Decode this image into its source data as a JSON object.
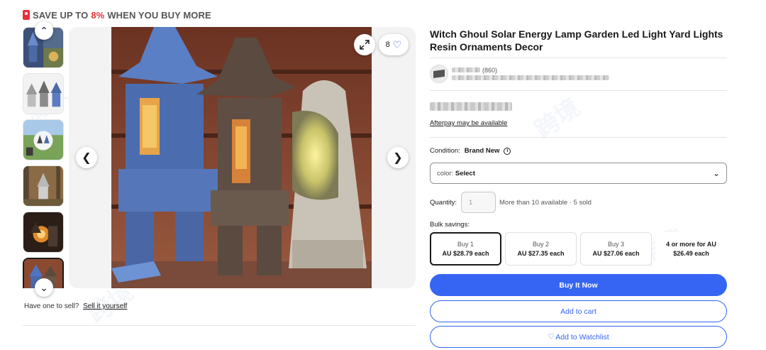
{
  "promo": {
    "prefix": "SAVE UP TO",
    "percent": "8%",
    "suffix": "WHEN YOU BUY MORE",
    "icon": "price-tag-icon"
  },
  "gallery": {
    "thumbnail_count": 6,
    "active_thumbnail": 6,
    "watch_count": "8",
    "icons": {
      "prev": "chevron-left-icon",
      "next": "chevron-right-icon",
      "expand": "expand-icon",
      "watch": "heart-icon",
      "thumb_up": "chevron-up-icon",
      "thumb_down": "chevron-down-icon"
    }
  },
  "sell": {
    "prompt": "Have one to sell?",
    "link": "Sell it yourself"
  },
  "listing": {
    "title": "Witch Ghoul Solar Energy Lamp Garden Led Light Yard Lights Resin Ornaments Decor",
    "seller_feedback_count": "(860)",
    "afterpay": "Afterpay may be available",
    "condition_label": "Condition:",
    "condition_value": "Brand New",
    "variation_label": "color:",
    "variation_value": "Select",
    "quantity_label": "Quantity:",
    "quantity_placeholder": "1",
    "availability": "More than 10 available · 5 sold",
    "bulk_label": "Bulk savings:",
    "bulk_options": [
      {
        "title": "Buy 1",
        "price": "AU $28.79 each",
        "selected": true
      },
      {
        "title": "Buy 2",
        "price": "AU $27.35 each",
        "selected": false
      },
      {
        "title": "Buy 3",
        "price": "AU $27.06 each",
        "selected": false
      },
      {
        "title": "4 or more for AU",
        "price": "$26.49 each",
        "selected": false
      }
    ],
    "buy_now": "Buy It Now",
    "add_to_cart": "Add to cart",
    "add_to_watchlist": "Add to Watchlist"
  },
  "colors": {
    "accent": "#3665f3",
    "promo_red": "#e53238",
    "text": "#191919"
  }
}
